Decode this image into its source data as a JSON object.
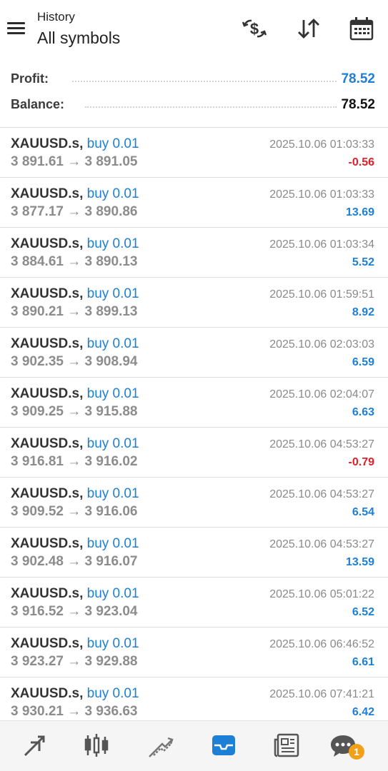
{
  "header": {
    "title": "History",
    "subtitle": "All symbols",
    "icons": [
      "menu-icon",
      "currency-exchange-icon",
      "sort-icon",
      "calendar-icon"
    ]
  },
  "summary": {
    "profit_label": "Profit:",
    "profit_value": "78.52",
    "balance_label": "Balance:",
    "balance_value": "78.52"
  },
  "colors": {
    "accent": "#1e7fd6",
    "loss": "#e0202a",
    "badge": "#f3a019"
  },
  "trades": [
    {
      "symbol": "XAUUSD.s,",
      "side": "buy 0.01",
      "prices": "3 891.61 → 3 891.05",
      "time": "2025.10.06 01:03:33",
      "pl": "-0.56",
      "type": "neg"
    },
    {
      "symbol": "XAUUSD.s,",
      "side": "buy 0.01",
      "prices": "3 877.17 → 3 890.86",
      "time": "2025.10.06 01:03:33",
      "pl": "13.69",
      "type": "pos"
    },
    {
      "symbol": "XAUUSD.s,",
      "side": "buy 0.01",
      "prices": "3 884.61 → 3 890.13",
      "time": "2025.10.06 01:03:34",
      "pl": "5.52",
      "type": "pos"
    },
    {
      "symbol": "XAUUSD.s,",
      "side": "buy 0.01",
      "prices": "3 890.21 → 3 899.13",
      "time": "2025.10.06 01:59:51",
      "pl": "8.92",
      "type": "pos"
    },
    {
      "symbol": "XAUUSD.s,",
      "side": "buy 0.01",
      "prices": "3 902.35 → 3 908.94",
      "time": "2025.10.06 02:03:03",
      "pl": "6.59",
      "type": "pos"
    },
    {
      "symbol": "XAUUSD.s,",
      "side": "buy 0.01",
      "prices": "3 909.25 → 3 915.88",
      "time": "2025.10.06 02:04:07",
      "pl": "6.63",
      "type": "pos"
    },
    {
      "symbol": "XAUUSD.s,",
      "side": "buy 0.01",
      "prices": "3 916.81 → 3 916.02",
      "time": "2025.10.06 04:53:27",
      "pl": "-0.79",
      "type": "neg"
    },
    {
      "symbol": "XAUUSD.s,",
      "side": "buy 0.01",
      "prices": "3 909.52 → 3 916.06",
      "time": "2025.10.06 04:53:27",
      "pl": "6.54",
      "type": "pos"
    },
    {
      "symbol": "XAUUSD.s,",
      "side": "buy 0.01",
      "prices": "3 902.48 → 3 916.07",
      "time": "2025.10.06 04:53:27",
      "pl": "13.59",
      "type": "pos"
    },
    {
      "symbol": "XAUUSD.s,",
      "side": "buy 0.01",
      "prices": "3 916.52 → 3 923.04",
      "time": "2025.10.06 05:01:22",
      "pl": "6.52",
      "type": "pos"
    },
    {
      "symbol": "XAUUSD.s,",
      "side": "buy 0.01",
      "prices": "3 923.27 → 3 929.88",
      "time": "2025.10.06 06:46:52",
      "pl": "6.61",
      "type": "pos"
    },
    {
      "symbol": "XAUUSD.s,",
      "side": "buy 0.01",
      "prices": "3 930.21 → 3 936.63",
      "time": "2025.10.06 07:41:21",
      "pl": "6.42",
      "type": "pos"
    }
  ],
  "bottom_nav": {
    "items": [
      "quotes-icon",
      "chart-icon",
      "trade-icon",
      "history-icon",
      "news-icon",
      "messages-icon"
    ],
    "active": "history-icon",
    "badge_count": "1"
  }
}
